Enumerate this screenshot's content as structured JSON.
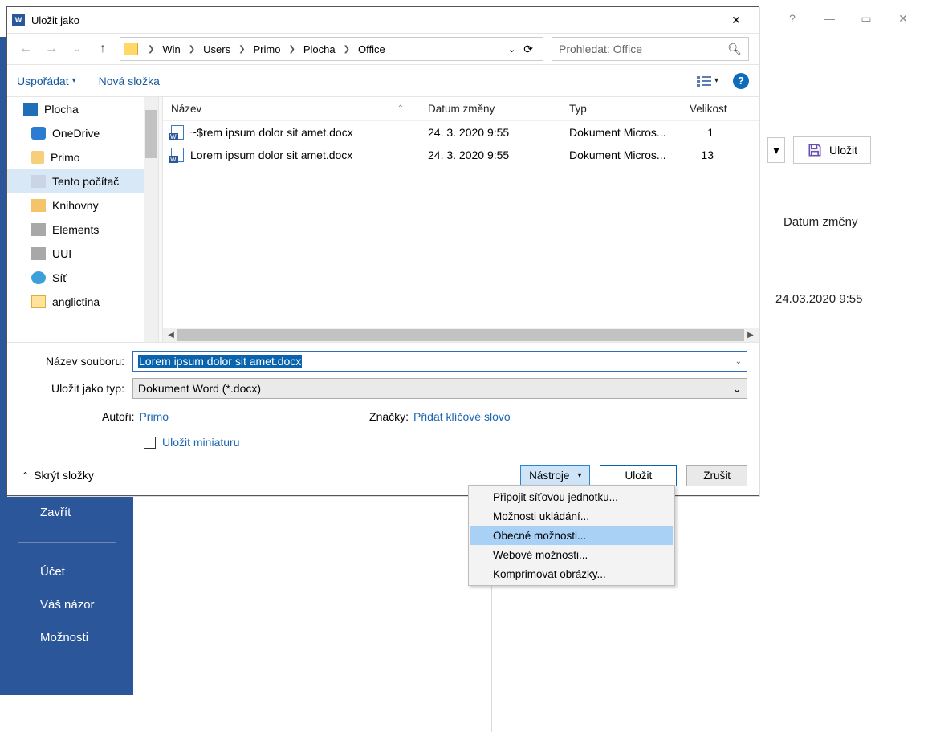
{
  "bg": {
    "save_label": "Uložit",
    "col_date": "Datum změny",
    "date_val": "24.03.2020 9:55",
    "sidebar": {
      "close": "Zavřít",
      "account": "Účet",
      "feedback": "Váš názor",
      "options": "Možnosti"
    }
  },
  "dialog": {
    "title": "Uložit jako",
    "breadcrumb": [
      "Win",
      "Users",
      "Primo",
      "Plocha",
      "Office"
    ],
    "search_placeholder": "Prohledat: Office",
    "toolbar": {
      "organize": "Uspořádat",
      "newfolder": "Nová složka"
    },
    "tree": [
      {
        "label": "Plocha",
        "icon": "ti-desktop",
        "root": true
      },
      {
        "label": "OneDrive",
        "icon": "ti-onedrive"
      },
      {
        "label": "Primo",
        "icon": "ti-user"
      },
      {
        "label": "Tento počítač",
        "icon": "ti-pc",
        "selected": true
      },
      {
        "label": "Knihovny",
        "icon": "ti-lib"
      },
      {
        "label": "Elements",
        "icon": "ti-drive"
      },
      {
        "label": "UUI",
        "icon": "ti-drive"
      },
      {
        "label": "Síť",
        "icon": "ti-net"
      },
      {
        "label": "anglictina",
        "icon": "ti-folder"
      }
    ],
    "columns": {
      "name": "Název",
      "date": "Datum změny",
      "type": "Typ",
      "size": "Velikost"
    },
    "rows": [
      {
        "name": "~$rem ipsum dolor sit amet.docx",
        "date": "24. 3. 2020 9:55",
        "type": "Dokument Micros...",
        "size": "1"
      },
      {
        "name": "Lorem ipsum dolor sit amet.docx",
        "date": "24. 3. 2020 9:55",
        "type": "Dokument Micros...",
        "size": "13"
      }
    ],
    "filename_label": "Název souboru:",
    "filename_value": "Lorem ipsum dolor sit amet.docx",
    "filetype_label": "Uložit jako typ:",
    "filetype_value": "Dokument Word (*.docx)",
    "authors_label": "Autoři:",
    "authors_value": "Primo",
    "tags_label": "Značky:",
    "tags_value": "Přidat klíčové slovo",
    "save_thumb": "Uložit miniaturu",
    "hide_folders": "Skrýt složky",
    "tools_btn": "Nástroje",
    "save_btn": "Uložit",
    "cancel_btn": "Zrušit"
  },
  "tools_menu": [
    "Připojit síťovou jednotku...",
    "Možnosti ukládání...",
    "Obecné možnosti...",
    "Webové možnosti...",
    "Komprimovat obrázky..."
  ],
  "tools_menu_hover_index": 2
}
